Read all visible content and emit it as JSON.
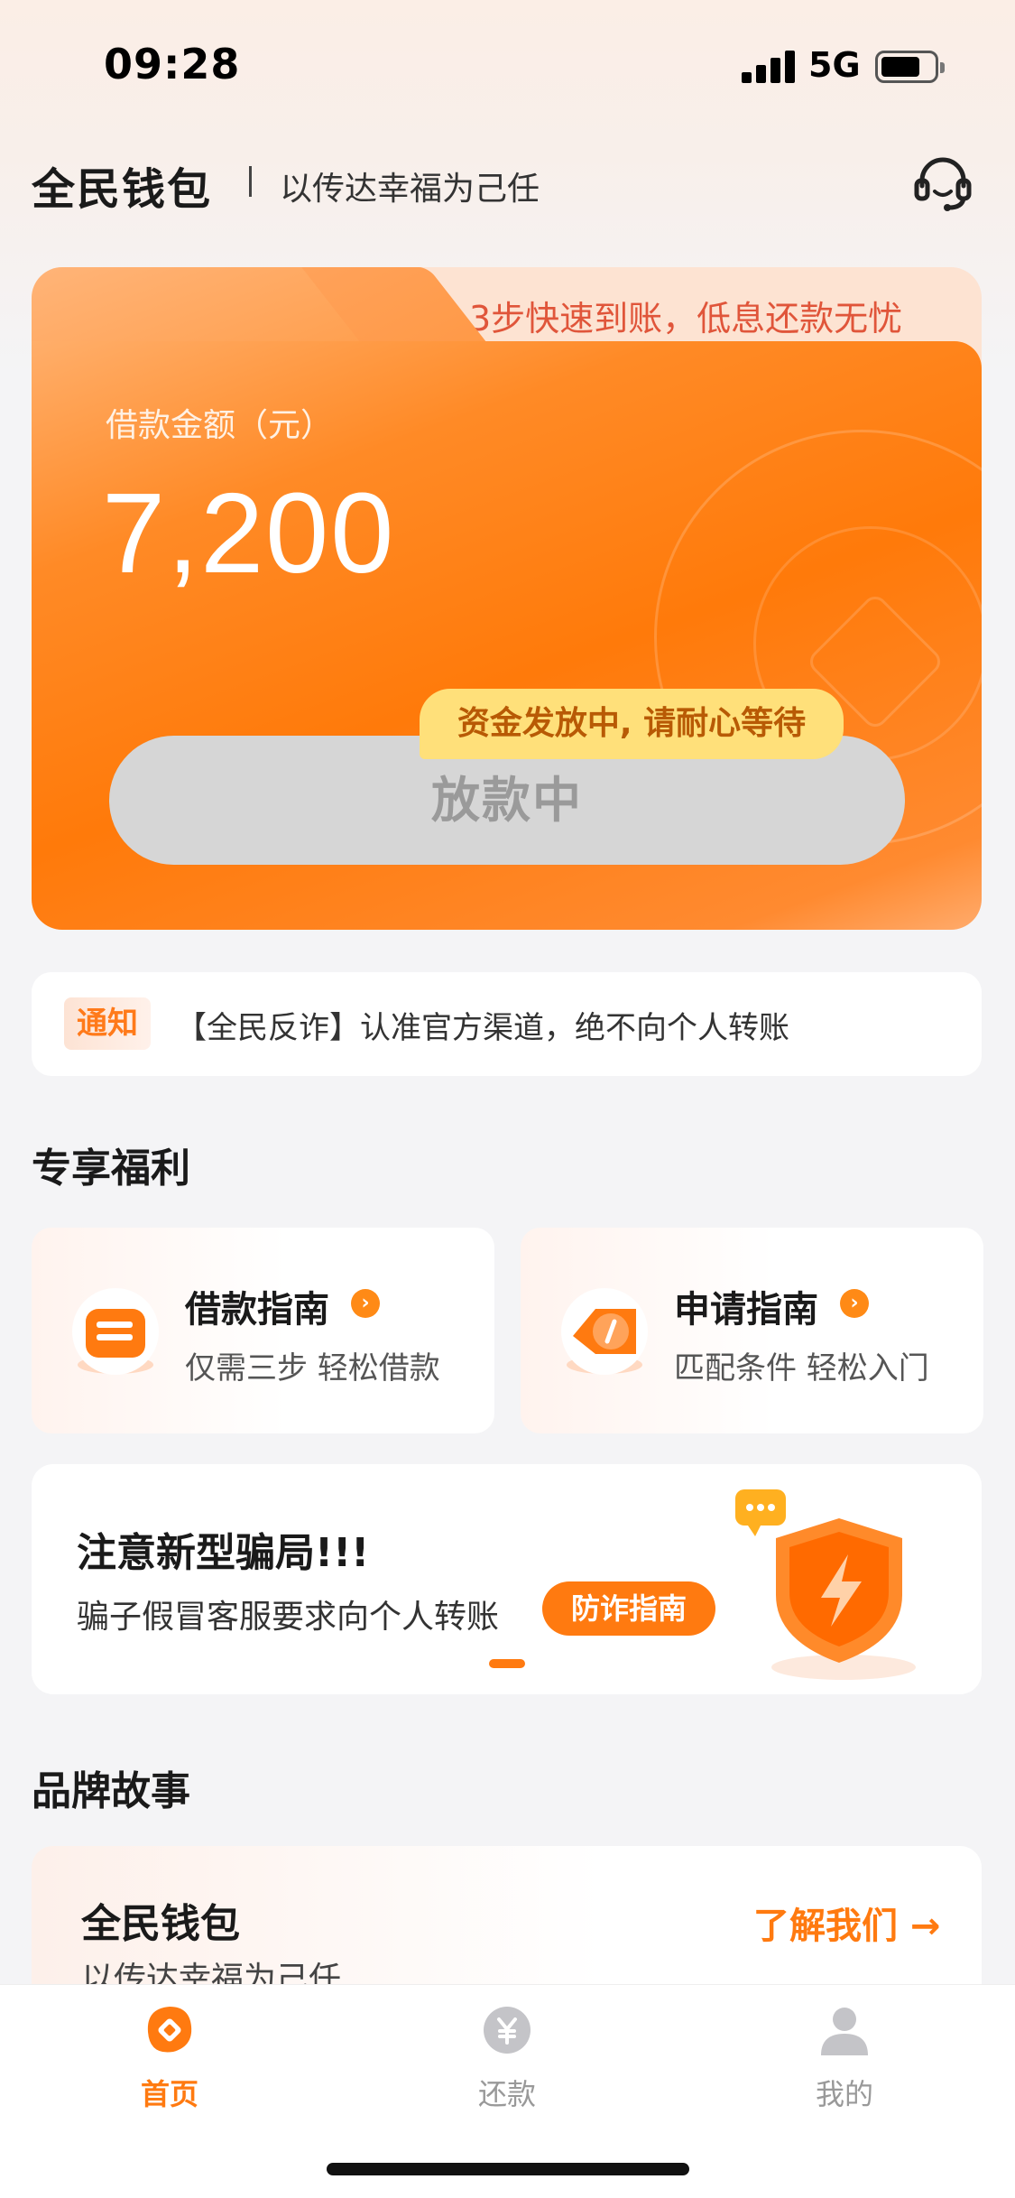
{
  "status_bar": {
    "time": "09:28",
    "network": "5G"
  },
  "header": {
    "brand": "全民钱包",
    "slogan": "以传达幸福为己任"
  },
  "loan_card": {
    "tab_text": "3步快速到账，低息还款无忧",
    "amount_label": "借款金额（元）",
    "amount": "7,200",
    "status_tip": "资金发放中, 请耐心等待",
    "status_button": "放款中"
  },
  "notice": {
    "tag": "通知",
    "text": "【全民反诈】认准官方渠道，绝不向个人转账"
  },
  "benefits": {
    "section_title": "专享福利",
    "items": [
      {
        "title": "借款指南",
        "subtitle": "仅需三步 轻松借款",
        "icon": "loan-guide-icon"
      },
      {
        "title": "申请指南",
        "subtitle": "匹配条件 轻松入门",
        "icon": "apply-guide-icon"
      }
    ]
  },
  "alert": {
    "title": "注意新型骗局!!!",
    "subtitle": "骗子假冒客服要求向个人转账",
    "button": "防诈指南"
  },
  "brand_story": {
    "section_title": "品牌故事",
    "title": "全民钱包",
    "subtitle": "以传达幸福为己任",
    "link": "了解我们 →"
  },
  "tab_bar": {
    "items": [
      {
        "label": "首页",
        "icon": "home-icon",
        "active": true
      },
      {
        "label": "还款",
        "icon": "repay-icon",
        "active": false
      },
      {
        "label": "我的",
        "icon": "profile-icon",
        "active": false
      }
    ]
  },
  "colors": {
    "accent": "#ff7a10",
    "tip_bg": "#ffe07a",
    "page_bg": "#f4f4f6"
  }
}
